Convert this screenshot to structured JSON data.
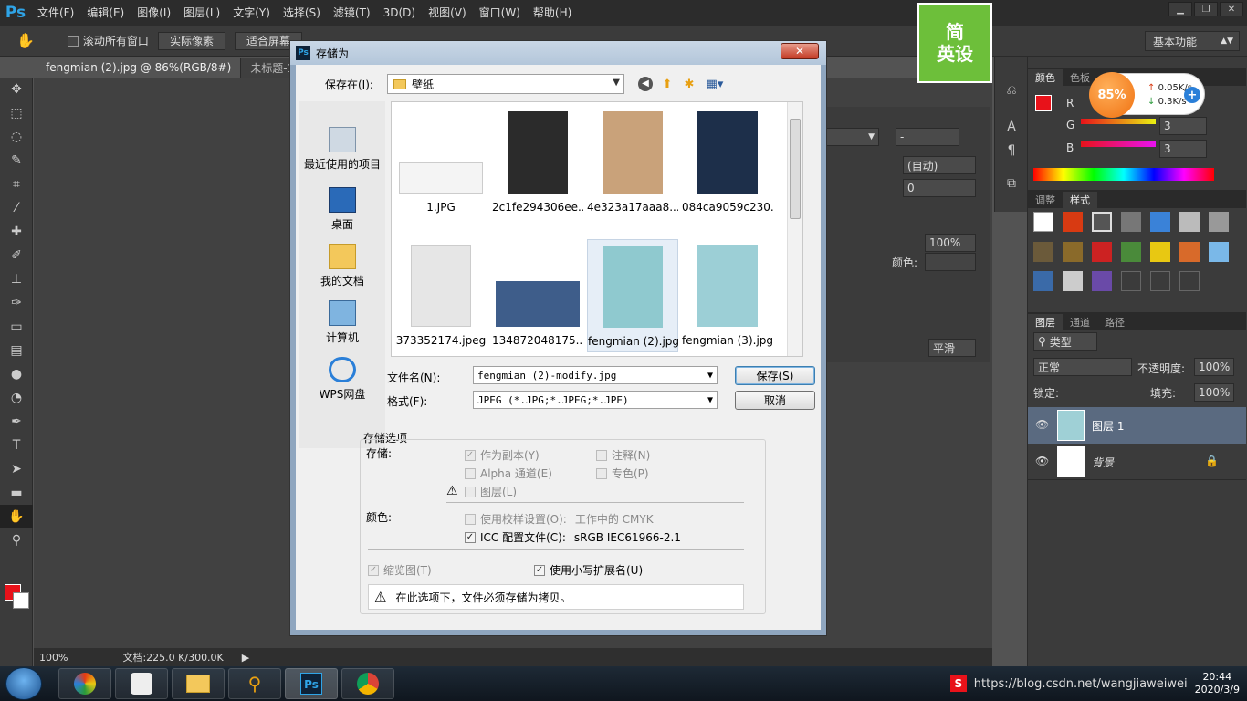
{
  "app": {
    "logo": "Ps",
    "menu": [
      "文件(F)",
      "编辑(E)",
      "图像(I)",
      "图层(L)",
      "文字(Y)",
      "选择(S)",
      "滤镜(T)",
      "3D(D)",
      "视图(V)",
      "窗口(W)",
      "帮助(H)"
    ],
    "options": {
      "scroll_all": "滚动所有窗口",
      "actual_pixels": "实际像素",
      "fit_screen": "适合屏幕"
    },
    "workspace": "基本功能",
    "doc_tabs": [
      "fengmian (2).jpg @ 86%(RGB/8#)",
      "未标题-1"
    ],
    "status": {
      "zoom": "100%",
      "doc": "文档:225.0 K/300.0K"
    }
  },
  "panels": {
    "color_tabs": [
      "颜色",
      "色板"
    ],
    "adjust_tabs": [
      "调整",
      "样式"
    ],
    "layer_tabs": [
      "图层",
      "通道",
      "路径"
    ],
    "channels": [
      "R",
      "G",
      "B"
    ],
    "g_value": "3",
    "b_value": "3",
    "kind": "类型",
    "blend_mode": "正常",
    "opacity_label": "不透明度:",
    "opacity": "100%",
    "lock_label": "锁定:",
    "fill_label": "填充:",
    "fill": "100%",
    "layers": [
      {
        "name": "图层 1"
      },
      {
        "name": "背景"
      }
    ],
    "char": {
      "leading": "(自动)",
      "tracking": "0",
      "scale": "100%",
      "color_label": "颜色:",
      "aa": "平滑",
      "dash1": "-"
    }
  },
  "overlay": {
    "logo_line1": "简",
    "logo_line2": "英设",
    "speed_pct": "85%",
    "up": "0.05K/s",
    "down": "0.3K/s"
  },
  "dialog": {
    "title": "存储为",
    "save_in_label": "保存在(I):",
    "save_in_value": "壁纸",
    "places": [
      "最近使用的项目",
      "桌面",
      "我的文档",
      "计算机",
      "WPS网盘"
    ],
    "files": [
      {
        "name": "1.JPG",
        "color": "#f4f4f4"
      },
      {
        "name": "2c1fe294306ee...",
        "color": "#2b2b2b"
      },
      {
        "name": "4e323a17aaa8...",
        "color": "#c9a27a"
      },
      {
        "name": "084ca9059c230...",
        "color": "#1d2f4a"
      },
      {
        "name": "373352174.jpeg",
        "color": "#e6e6e6"
      },
      {
        "name": "134872048175...",
        "color": "#3e5d8a"
      },
      {
        "name": "fengmian (2).jpg",
        "color": "#8fc9cf"
      },
      {
        "name": "fengmian (3).jpg",
        "color": "#9ccfd6"
      }
    ],
    "filename_label": "文件名(N):",
    "filename_value": "fengmian (2)-modify.jpg",
    "format_label": "格式(F):",
    "format_value": "JPEG (*.JPG;*.JPEG;*.JPE)",
    "save_btn": "保存(S)",
    "cancel_btn": "取消",
    "options_title": "存储选项",
    "save_label": "存储:",
    "as_copy": "作为副本(Y)",
    "alpha": "Alpha 通道(E)",
    "layers_opt": "图层(L)",
    "notes": "注释(N)",
    "spot": "专色(P)",
    "color_label": "颜色:",
    "proof": "使用校样设置(O):",
    "proof_value": "工作中的 CMYK",
    "icc": "ICC 配置文件(C):",
    "icc_value": "sRGB IEC61966-2.1",
    "thumbnail": "缩览图(T)",
    "lowercase": "使用小写扩展名(U)",
    "warning": "在此选项下，文件必须存储为拷贝。"
  },
  "taskbar": {
    "ps_label": "Ps",
    "url": "https://blog.csdn.net/wangjiaweiwei",
    "time": "20:44",
    "date": "2020/3/9"
  }
}
